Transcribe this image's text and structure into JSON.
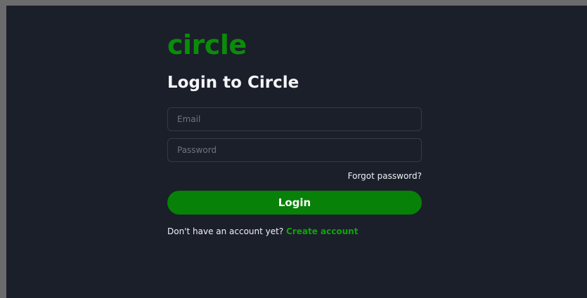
{
  "colors": {
    "brand": "#0a8c0a",
    "button": "#078107",
    "link": "#10a20c"
  },
  "logo": {
    "text": "circle"
  },
  "title": "Login to Circle",
  "form": {
    "email_placeholder": "Email",
    "password_placeholder": "Password",
    "forgot_label": "Forgot password?",
    "login_label": "Login"
  },
  "signup": {
    "prompt": "Don't have an account yet?",
    "link_label": "Create account"
  }
}
